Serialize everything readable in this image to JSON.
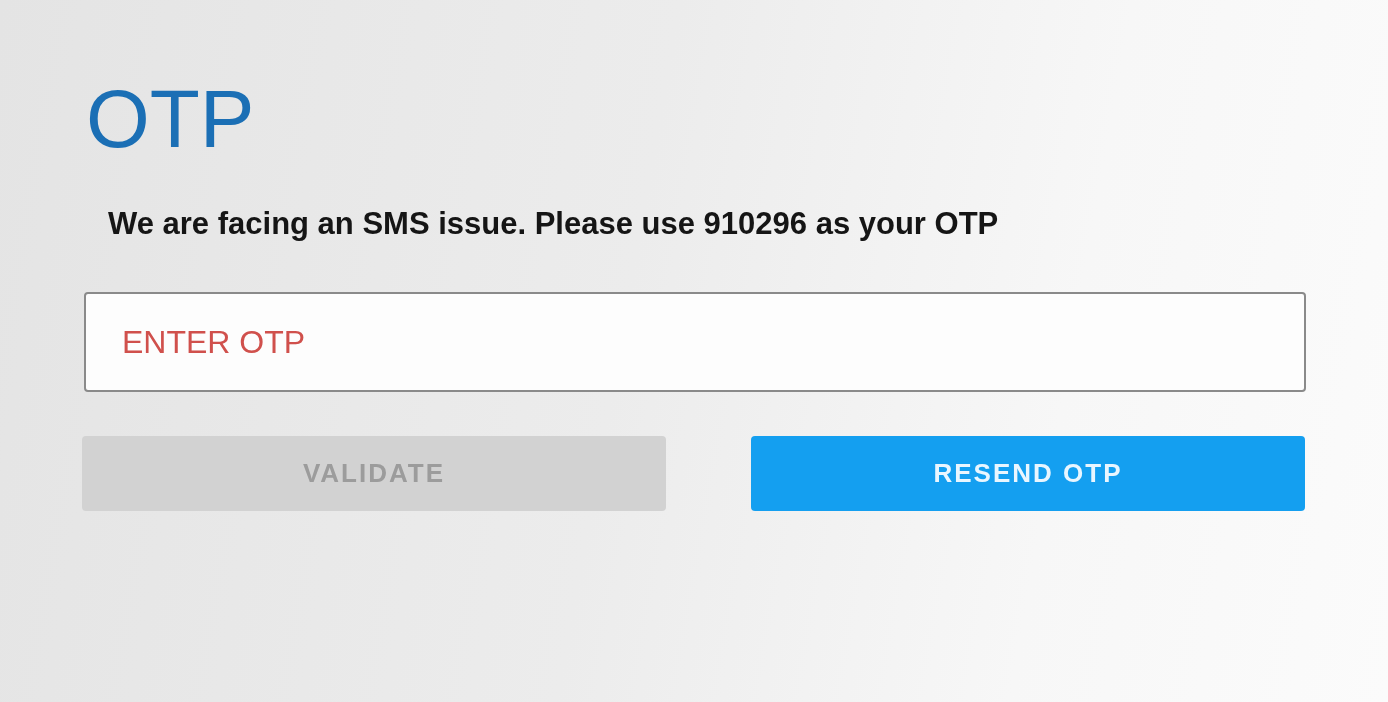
{
  "title": "OTP",
  "message": "We are facing an SMS issue. Please use 910296 as your OTP",
  "otp_field": {
    "placeholder": "ENTER OTP"
  },
  "buttons": [
    {
      "label": "VALIDATE",
      "disabled": true
    },
    {
      "label": "RESEND OTP",
      "disabled": false
    }
  ]
}
